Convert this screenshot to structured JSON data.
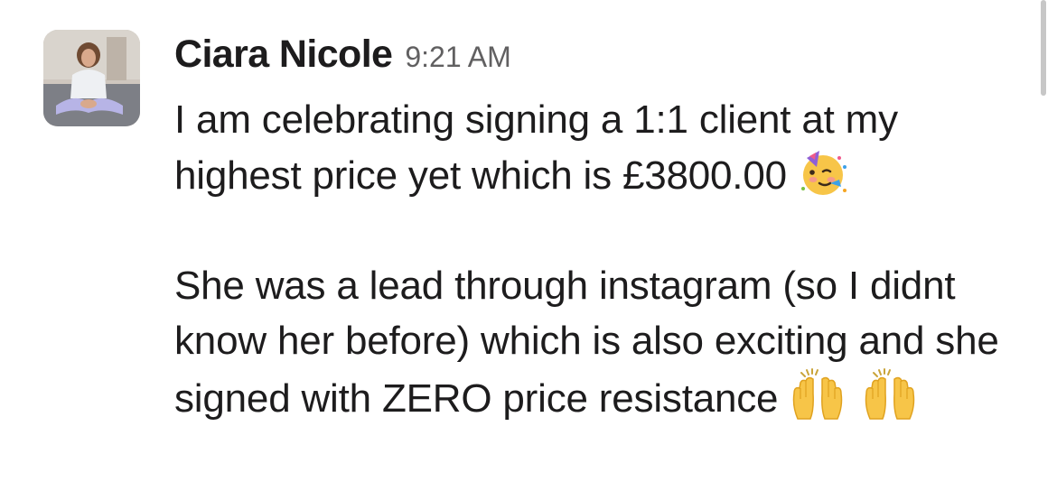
{
  "message": {
    "sender": "Ciara Nicole",
    "timestamp": "9:21 AM",
    "paragraph_1": "I am celebrating signing a 1:1 client at my highest price yet which is £3800.00",
    "paragraph_2": "She was a lead through instagram (so I didnt know her before) which is also exciting and she signed with ZERO price resistance",
    "emoji_1": "partying-face-icon",
    "emoji_2": "raising-hands-icon",
    "emoji_3": "raising-hands-icon"
  }
}
